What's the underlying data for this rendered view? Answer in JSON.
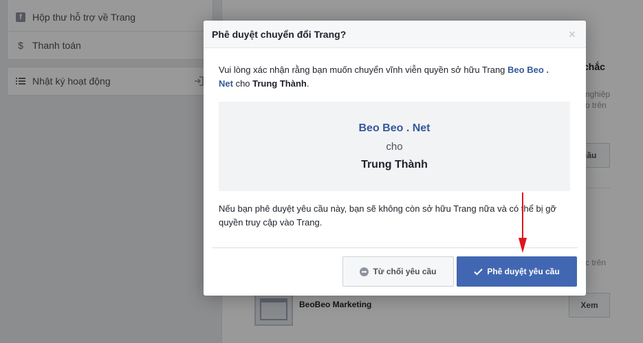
{
  "sidebar": {
    "items": [
      {
        "label": "Hộp thư hỗ trợ về Trang",
        "icon": "facebook-square-icon"
      },
      {
        "label": "Thanh toán",
        "icon": "dollar-icon"
      }
    ],
    "activity_log": {
      "label": "Nhật ký hoạt động",
      "icon": "list-icon",
      "action_icon": "exit-icon"
    }
  },
  "background": {
    "fragment_1": "chắc",
    "fragment_2": "nghiệp",
    "fragment_3": "o trên",
    "fragment_4": "c trên",
    "request_button": "cầu",
    "page_name": "BeoBeo Marketing",
    "view_button": "Xem"
  },
  "dialog": {
    "title": "Phê duyệt chuyển đổi Trang?",
    "close_icon": "close-icon",
    "message": {
      "before": "Vui lòng xác nhận rằng bạn muốn chuyển vĩnh viễn quyền sở hữu Trang ",
      "page_name": "Beo Beo . Net",
      "middle": " cho ",
      "owner": "Trung Thành",
      "after": "."
    },
    "summary": {
      "page_name": "Beo Beo . Net",
      "connector": "cho",
      "owner": "Trung Thành"
    },
    "warning": "Nếu bạn phê duyệt yêu cầu này, bạn sẽ không còn sở hữu Trang nữa và có thể bị gỡ quyền truy cập vào Trang.",
    "buttons": {
      "decline": "Từ chối yêu cầu",
      "approve": "Phê duyệt yêu cầu"
    }
  },
  "colors": {
    "primary": "#4267b2",
    "link": "#365899",
    "annotation": "#e0141e"
  }
}
